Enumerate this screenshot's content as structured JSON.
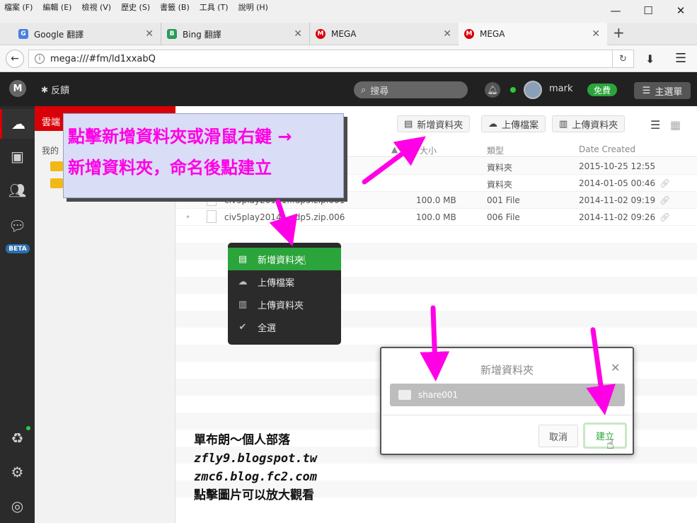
{
  "browser": {
    "menu": [
      "檔案 (F)",
      "編輯 (E)",
      "檢視 (V)",
      "歷史 (S)",
      "書籤 (B)",
      "工具 (T)",
      "說明 (H)"
    ],
    "window_controls": {
      "minimize": "—",
      "maximize": "☐",
      "close": "✕"
    },
    "tabs": [
      {
        "label": "Google 翻譯",
        "icon": "google-translate-icon",
        "color": "#4a7fe0"
      },
      {
        "label": "Bing 翻譯",
        "icon": "bing-translate-icon",
        "color": "#2a9b5a"
      },
      {
        "label": "MEGA",
        "icon": "mega-icon",
        "color": "#d90007"
      },
      {
        "label": "MEGA",
        "icon": "mega-icon",
        "color": "#d90007",
        "active": true
      }
    ],
    "url": "mega:///#fm/ld1xxabQ"
  },
  "mega_header": {
    "logo": "M",
    "feedback": "反饋",
    "search_placeholder": "搜尋",
    "username": "mark",
    "plan_badge": "免費",
    "main_menu": "主選單"
  },
  "rail": {
    "beta": "BETA"
  },
  "tree": {
    "header": "雲端",
    "subheader": "我的"
  },
  "toolbar": {
    "new_folder": "新增資料夾",
    "upload_file": "上傳檔案",
    "upload_folder": "上傳資料夾"
  },
  "table": {
    "headers": {
      "size": "大小",
      "type": "類型",
      "date": "Date Created"
    },
    "rows": [
      {
        "name": "",
        "size": "",
        "type": "資料夾",
        "date": "2015-10-25 12:55",
        "link": false
      },
      {
        "name": "",
        "size": "",
        "type": "資料夾",
        "date": "2014-01-05 00:46",
        "link": true
      },
      {
        "name": "civ5play20141...dp5.zip.001",
        "size": "100.0 MB",
        "type": "001 File",
        "date": "2014-11-02 09:19",
        "link": true
      },
      {
        "name": "civ5play20141...dp5.zip.006",
        "size": "100.0 MB",
        "type": "006 File",
        "date": "2014-11-02 09:26",
        "link": true
      }
    ]
  },
  "context_menu": {
    "items": [
      {
        "label": "新增資料夾",
        "highlighted": true
      },
      {
        "label": "上傳檔案",
        "highlighted": false
      },
      {
        "label": "上傳資料夾",
        "highlighted": false
      },
      {
        "label": "全選",
        "highlighted": false
      }
    ]
  },
  "dialog": {
    "title": "新增資料夾",
    "folder_name": "share001",
    "cancel": "取消",
    "create": "建立"
  },
  "annotation": {
    "callout_line1": "點擊新增資料夾或滑鼠右鍵 →",
    "callout_line2": "新增資料夾，命名後點建立",
    "blog_line1": "單布朗～個人部落",
    "blog_line2": "zfly9.blogspot.tw",
    "blog_line3": "zmc6.blog.fc2.com",
    "blog_line4": "點擊圖片可以放大觀看",
    "arrow_color": "#ff00e6"
  },
  "colors": {
    "mega_red": "#d90007",
    "mega_green": "#2ba43b",
    "dark": "#212121"
  }
}
